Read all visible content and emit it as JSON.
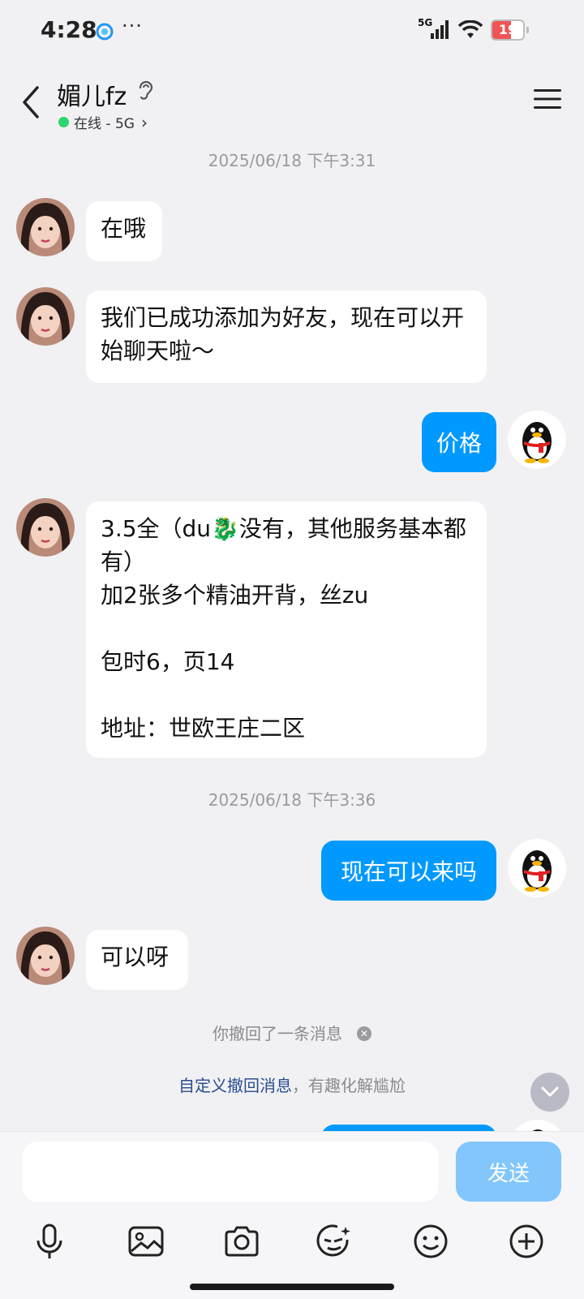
{
  "status_bar": {
    "time": "4:28",
    "more": "···",
    "network": "5G",
    "battery": "19"
  },
  "header": {
    "contact_name": "媚儿fz",
    "status": "在线 - 5G",
    "status_arrow": "›"
  },
  "messages": {
    "ts1": "2025/06/18 下午3:31",
    "m1": "在哦",
    "m2": "我们已成功添加为好友，现在可以开始聊天啦～",
    "m3": "价格",
    "m4": "3.5全（du🐉没有，其他服务基本都有）\n加2张多个精油开背，丝zu\n\n包时6，页14\n\n地址：世欧王庄二区",
    "ts2": "2025/06/18 下午3:36",
    "m5": "现在可以来吗",
    "m6": "可以呀",
    "recall_notice": "你撤回了一条消息",
    "custom_link": "自定义撤回消息",
    "custom_rest": "，有趣化解尴尬"
  },
  "composer": {
    "input_value": "",
    "send_label": "发送"
  },
  "toolbar": {
    "icons": [
      "mic-icon",
      "image-icon",
      "camera-icon",
      "face-edit-icon",
      "emoji-icon",
      "plus-icon"
    ]
  },
  "colors": {
    "accent": "#0099ff",
    "online": "#2fd470",
    "background": "#f1f1f4"
  }
}
